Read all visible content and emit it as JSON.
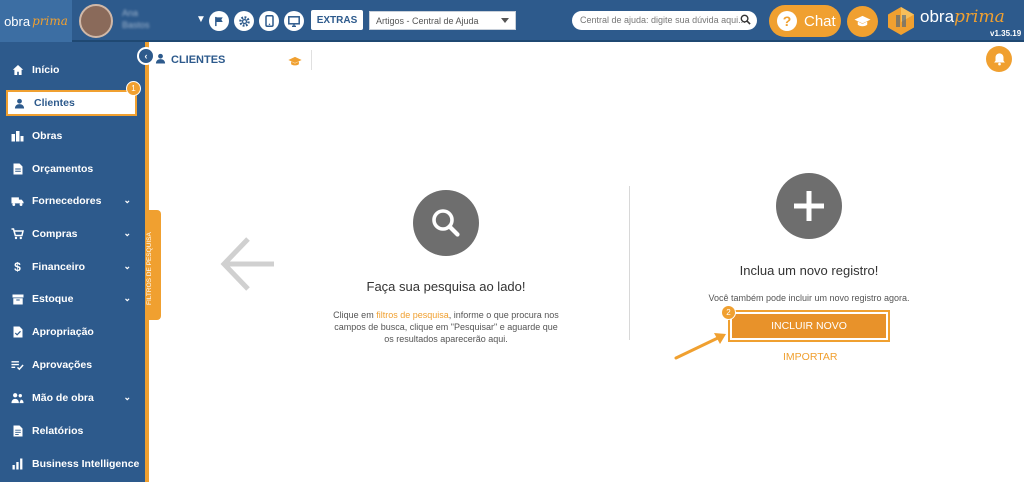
{
  "topbar": {
    "logo_text": "obra",
    "logo_text_accent": "prima",
    "user_name_line1": "Ana",
    "user_name_line2": "Bastos",
    "extras_label": "EXTRAS",
    "help_select_value": "Artigos - Central de Ajuda",
    "search_placeholder": "Central de ajuda: digite sua dúvida aqui...",
    "chat_label": "Chat",
    "brand_text": "obra",
    "brand_text_accent": "prima",
    "version": "v1.35.19",
    "icons": [
      "flag-icon",
      "gear-icon",
      "mobile-icon",
      "monitor-icon",
      "graduation-cap-icon"
    ]
  },
  "sidebar": {
    "items": [
      {
        "label": "Início",
        "icon": "home-icon"
      },
      {
        "label": "Clientes",
        "icon": "user-icon",
        "badge": "1"
      },
      {
        "label": "Obras",
        "icon": "buildings-icon"
      },
      {
        "label": "Orçamentos",
        "icon": "document-icon"
      },
      {
        "label": "Fornecedores",
        "icon": "truck-icon"
      },
      {
        "label": "Compras",
        "icon": "cart-icon"
      },
      {
        "label": "Financeiro",
        "icon": "dollar-icon"
      },
      {
        "label": "Estoque",
        "icon": "box-icon"
      },
      {
        "label": "Apropriação",
        "icon": "document-check-icon"
      },
      {
        "label": "Aprovações",
        "icon": "checklist-icon"
      },
      {
        "label": "Mão de obra",
        "icon": "workers-icon"
      },
      {
        "label": "Relatórios",
        "icon": "report-icon"
      },
      {
        "label": "Business Intelligence",
        "icon": "bar-chart-icon"
      }
    ],
    "filter_tab_label": "FILTROS DE PESQUISA"
  },
  "main": {
    "page_title": "CLIENTES",
    "left_panel": {
      "heading": "Faça sua pesquisa ao lado!",
      "text_before_link": "Clique em ",
      "link_text": "filtros de pesquisa",
      "text_after_link_line1": ", informe o que procura nos",
      "text_line2": "campos de busca, clique em \"Pesquisar\" e aguarde que",
      "text_line3": "os resultados aparecerão aqui."
    },
    "right_panel": {
      "heading": "Inclua um novo registro!",
      "subtext": "Você também pode incluir um novo registro agora.",
      "primary_button": "INCLUIR NOVO",
      "primary_badge": "2",
      "secondary_link": "IMPORTAR"
    }
  },
  "colors": {
    "primary_blue": "#2d5a8c",
    "accent_orange": "#f0a030",
    "icon_gray": "#6e6e6e"
  }
}
